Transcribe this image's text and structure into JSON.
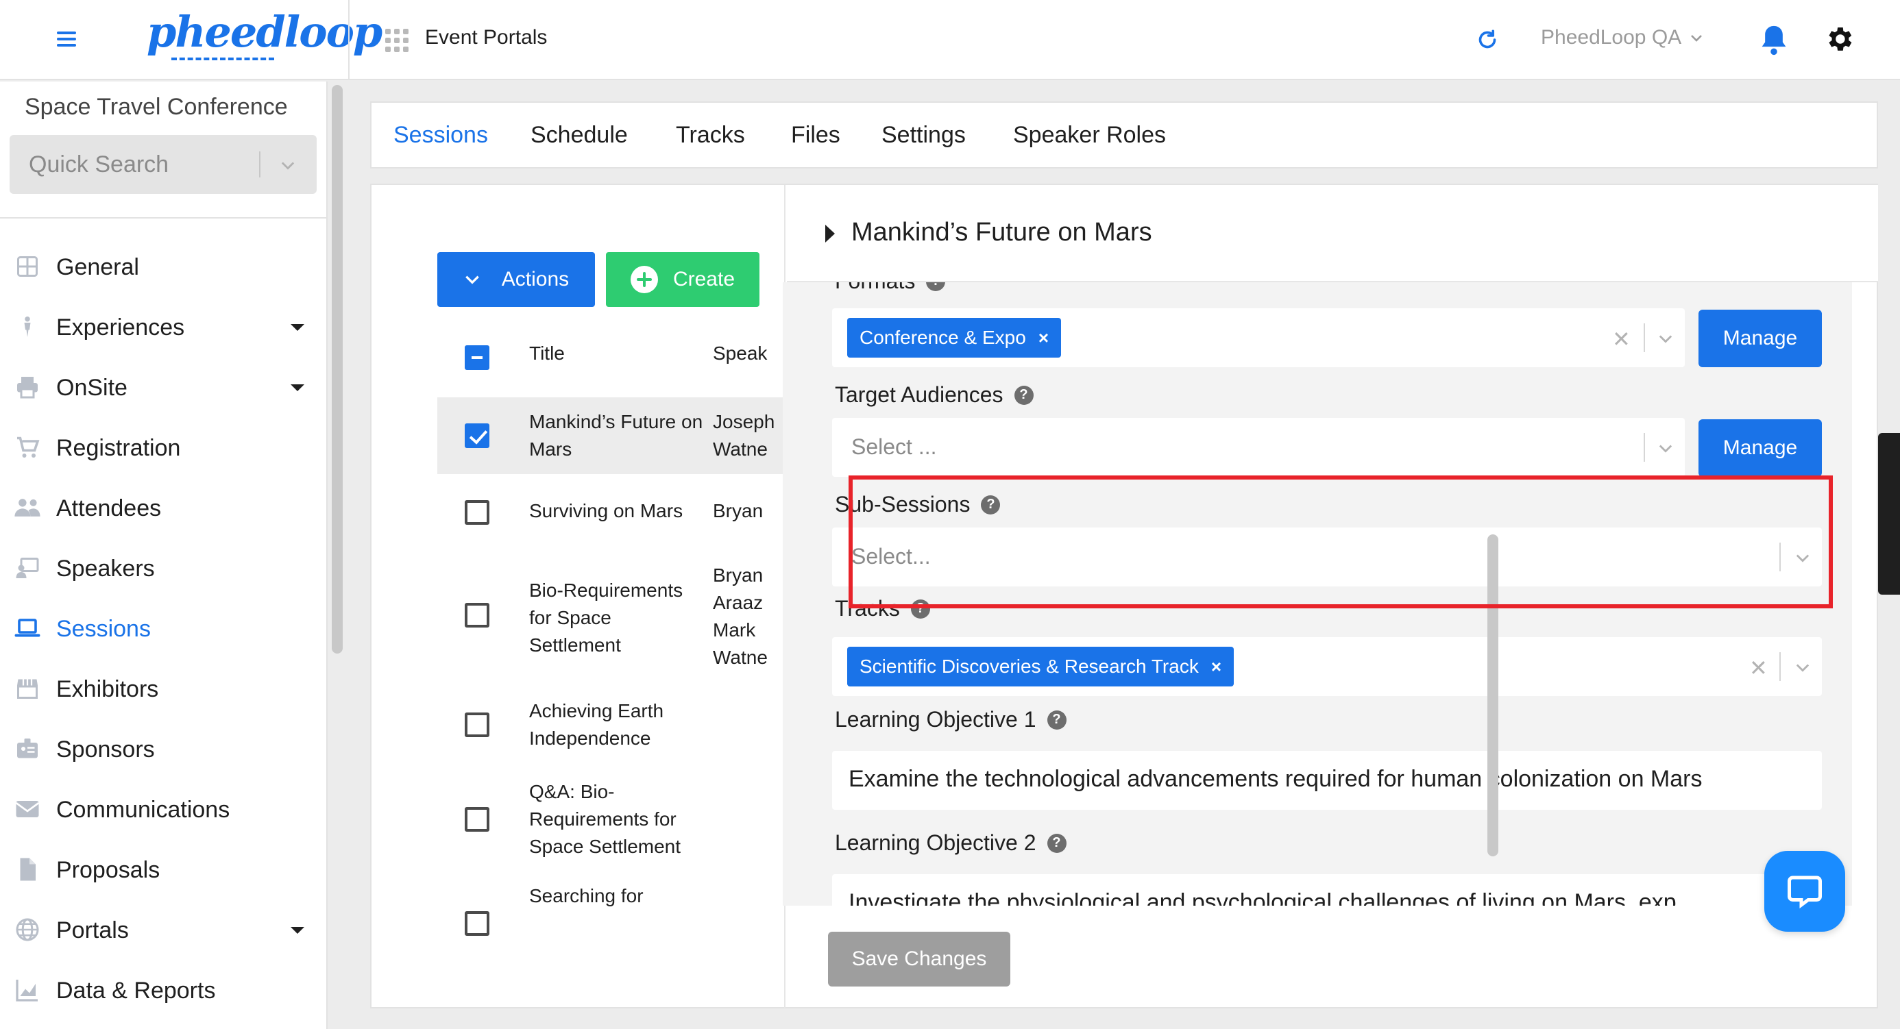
{
  "topbar": {
    "logo_text": "pheedloop",
    "section_title": "Event Portals",
    "account_name": "PheedLoop QA"
  },
  "sidebar": {
    "event_name": "Space Travel Conference",
    "search_placeholder": "Quick Search",
    "items": [
      {
        "label": "General",
        "icon": "grid-icon",
        "has_caret": false
      },
      {
        "label": "Experiences",
        "icon": "person-icon",
        "has_caret": true
      },
      {
        "label": "OnSite",
        "icon": "printer-icon",
        "has_caret": true
      },
      {
        "label": "Registration",
        "icon": "cart-icon",
        "has_caret": false
      },
      {
        "label": "Attendees",
        "icon": "people-icon",
        "has_caret": false
      },
      {
        "label": "Speakers",
        "icon": "presenter-icon",
        "has_caret": false
      },
      {
        "label": "Sessions",
        "icon": "laptop-icon",
        "has_caret": false,
        "active": true
      },
      {
        "label": "Exhibitors",
        "icon": "store-icon",
        "has_caret": false
      },
      {
        "label": "Sponsors",
        "icon": "badge-icon",
        "has_caret": false
      },
      {
        "label": "Communications",
        "icon": "mail-icon",
        "has_caret": false
      },
      {
        "label": "Proposals",
        "icon": "document-icon",
        "has_caret": false
      },
      {
        "label": "Portals",
        "icon": "globe-icon",
        "has_caret": true
      },
      {
        "label": "Data & Reports",
        "icon": "chart-icon",
        "has_caret": false
      }
    ]
  },
  "tabs": [
    "Sessions",
    "Schedule",
    "Tracks",
    "Files",
    "Settings",
    "Speaker Roles"
  ],
  "list": {
    "actions_label": "Actions",
    "create_label": "Create",
    "col_title": "Title",
    "col_speakers": "Speak",
    "rows": [
      {
        "title": "Mankind’s Future on Mars",
        "speakers": "Joseph\nWatne",
        "checked": true
      },
      {
        "title": "Surviving on Mars",
        "speakers": "Bryan",
        "checked": false
      },
      {
        "title": "Bio-Requirements for Space Settlement",
        "speakers": "Bryan\nAraaz\nMark\nWatne",
        "checked": false
      },
      {
        "title": "Achieving Earth Independence",
        "speakers": "",
        "checked": false
      },
      {
        "title": "Q&A: Bio-Requirements for Space Settlement",
        "speakers": "",
        "checked": false
      },
      {
        "title": "Searching for",
        "speakers": "",
        "checked": false
      }
    ]
  },
  "detail": {
    "title": "Mankind’s Future on Mars",
    "formats_label": "Formats",
    "formats_chip": "Conference & Expo",
    "manage_label": "Manage",
    "target_audiences_label": "Target Audiences",
    "target_audiences_placeholder": "Select ...",
    "sub_sessions_label": "Sub-Sessions",
    "sub_sessions_placeholder": "Select...",
    "tracks_label": "Tracks",
    "tracks_chip": "Scientific Discoveries & Research Track",
    "lo1_label": "Learning Objective 1",
    "lo1_value": "Examine the technological advancements required for human colonization on Mars",
    "lo2_label": "Learning Objective 2",
    "lo2_value": "Investigate the physiological and psychological challenges of living on Mars, exp",
    "save_label": "Save Changes"
  },
  "colors": {
    "accent": "#1a73e8",
    "create": "#2ecc71",
    "highlight": "#e8232a"
  }
}
